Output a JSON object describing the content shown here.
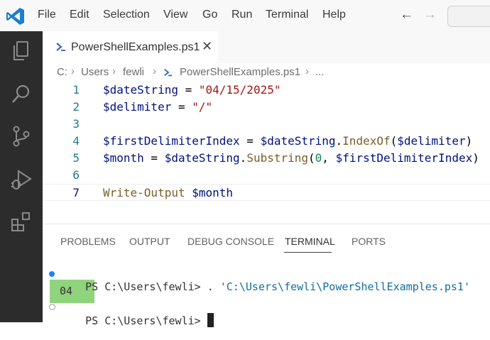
{
  "menu": [
    "File",
    "Edit",
    "Selection",
    "View",
    "Go",
    "Run",
    "Terminal",
    "Help"
  ],
  "nav": {
    "back_icon": "arrow-left-icon",
    "forward_icon": "arrow-right-icon"
  },
  "activity_icons": [
    "explorer-icon",
    "search-icon",
    "source-control-icon",
    "run-debug-icon",
    "extensions-icon"
  ],
  "tab": {
    "label": "PowerShellExamples.ps1",
    "close": "✕"
  },
  "breadcrumb": [
    "C:",
    "Users",
    "fewli",
    "PowerShellExamples.ps1",
    "..."
  ],
  "editor": {
    "lines": [
      {
        "num": "1",
        "tokens": [
          [
            "var",
            "$dateString"
          ],
          [
            "plain",
            " = "
          ],
          [
            "str",
            "\"04/15/2025\""
          ]
        ]
      },
      {
        "num": "2",
        "tokens": [
          [
            "var",
            "$delimiter"
          ],
          [
            "plain",
            " = "
          ],
          [
            "str",
            "\"/\""
          ]
        ]
      },
      {
        "num": "3",
        "tokens": []
      },
      {
        "num": "4",
        "tokens": [
          [
            "var",
            "$firstDelimiterIndex"
          ],
          [
            "plain",
            " = "
          ],
          [
            "var",
            "$dateString"
          ],
          [
            "plain",
            "."
          ],
          [
            "method",
            "IndexOf"
          ],
          [
            "plain",
            "("
          ],
          [
            "var",
            "$delimiter"
          ],
          [
            "plain",
            ")"
          ]
        ]
      },
      {
        "num": "5",
        "tokens": [
          [
            "var",
            "$month"
          ],
          [
            "plain",
            " = "
          ],
          [
            "var",
            "$dateString"
          ],
          [
            "plain",
            "."
          ],
          [
            "method",
            "Substring"
          ],
          [
            "plain",
            "("
          ],
          [
            "num",
            "0"
          ],
          [
            "plain",
            ", "
          ],
          [
            "var",
            "$firstDelimiterIndex"
          ],
          [
            "plain",
            ")"
          ]
        ]
      },
      {
        "num": "6",
        "tokens": []
      },
      {
        "num": "7",
        "tokens": [
          [
            "method",
            "Write-Output"
          ],
          [
            "plain",
            " "
          ],
          [
            "var",
            "$month"
          ]
        ]
      }
    ]
  },
  "panel": {
    "tabs": [
      "PROBLEMS",
      "OUTPUT",
      "DEBUG CONSOLE",
      "TERMINAL",
      "PORTS"
    ],
    "active_tab": "TERMINAL"
  },
  "terminal": {
    "prompt1": "PS C:\\Users\\fewli> ",
    "command_dot": ". ",
    "command_path": "'C:\\Users\\fewli\\PowerShellExamples.ps1'",
    "output": "04",
    "prompt2": "PS C:\\Users\\fewli> "
  },
  "colors": {
    "accent": "#0078d4",
    "activity_bar": "#2c2c2c",
    "string": "#a31515",
    "variable": "#001080",
    "method": "#795e26",
    "number": "#098658",
    "line_number": "#237893",
    "output_highlight": "#8fd37d"
  }
}
